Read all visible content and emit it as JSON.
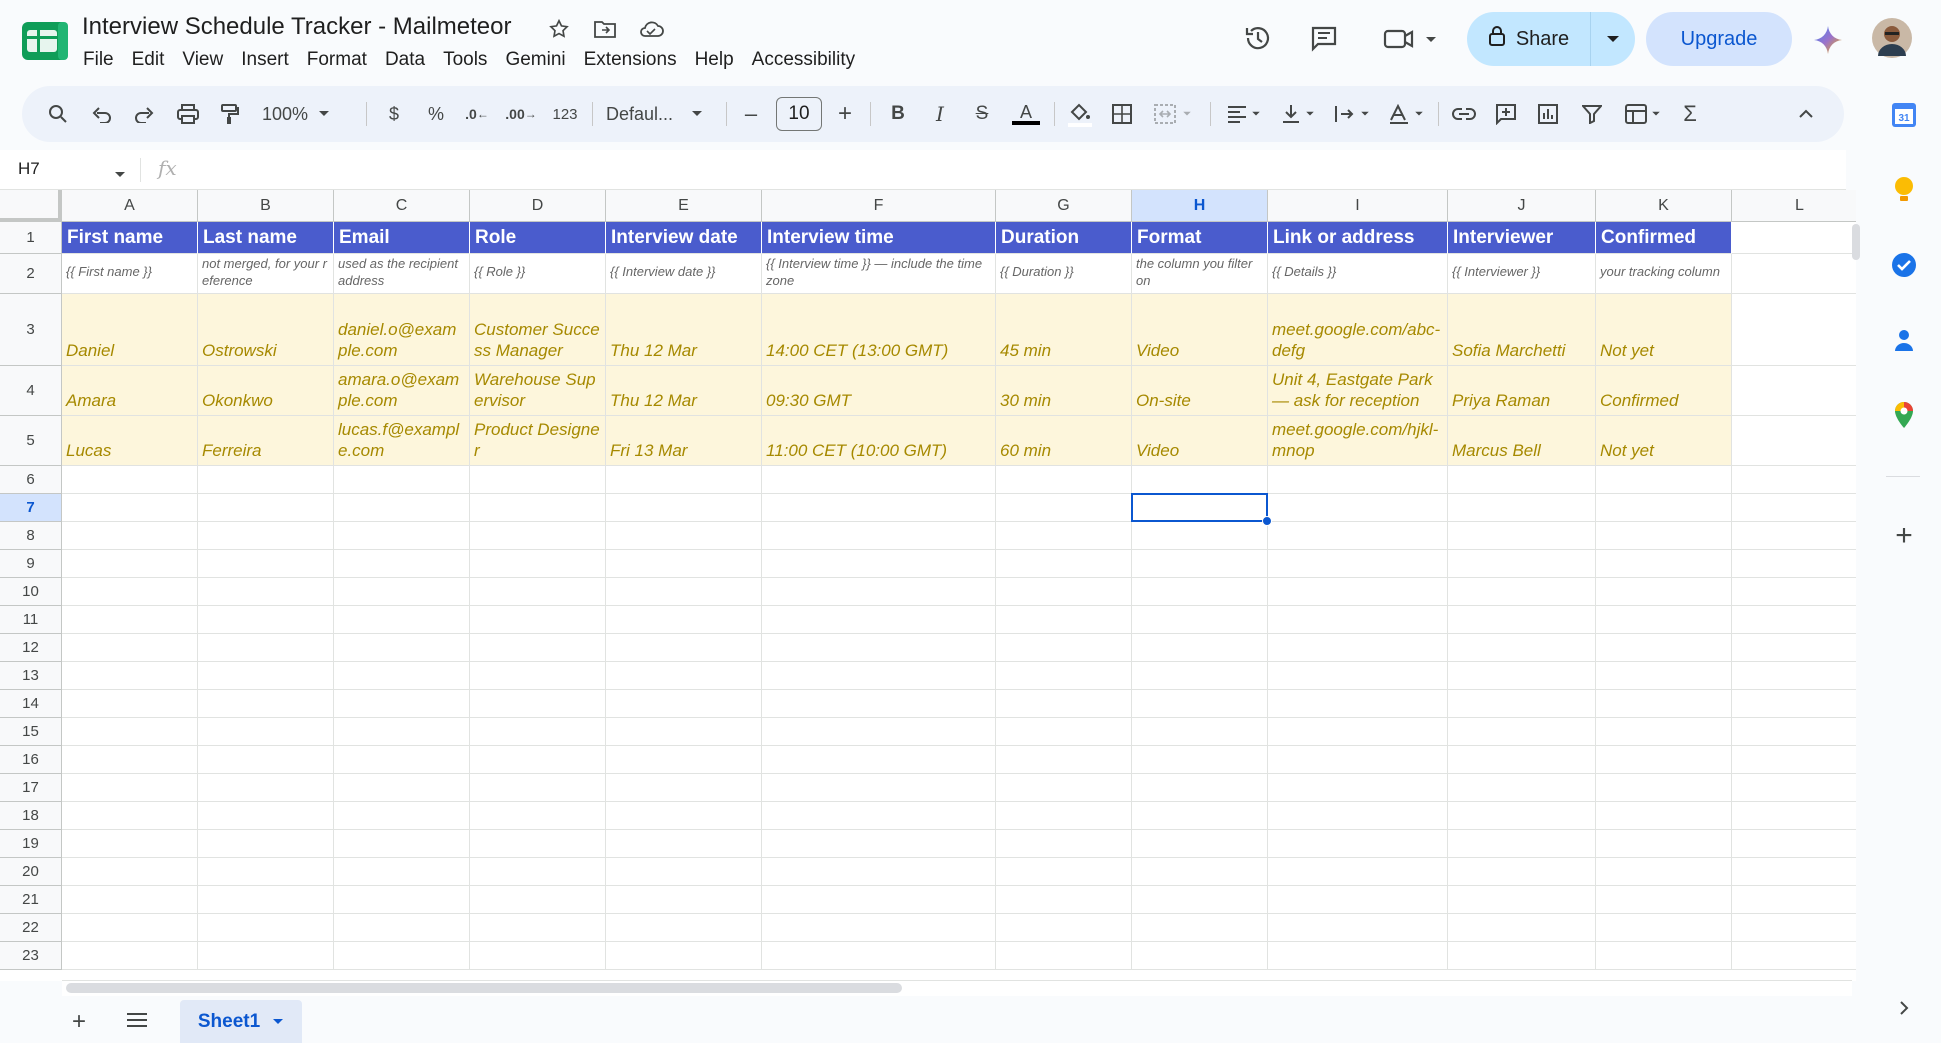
{
  "doc": {
    "title": "Interview Schedule Tracker - Mailmeteor"
  },
  "menu": [
    "File",
    "Edit",
    "View",
    "Insert",
    "Format",
    "Data",
    "Tools",
    "Gemini",
    "Extensions",
    "Help",
    "Accessibility"
  ],
  "header_actions": {
    "share_label": "Share",
    "upgrade_label": "Upgrade"
  },
  "toolbar": {
    "zoom": "100%",
    "currency": "$",
    "percent": "%",
    "format_123": "123",
    "font": "Defaul...",
    "font_size": "10"
  },
  "formula_bar": {
    "name_box": "H7",
    "fx": "fx",
    "value": ""
  },
  "grid": {
    "selected_cell": "H7",
    "columns": [
      "A",
      "B",
      "C",
      "D",
      "E",
      "F",
      "G",
      "H",
      "I",
      "J",
      "K",
      "L"
    ],
    "rows": [
      "1",
      "2",
      "3",
      "4",
      "5",
      "6",
      "7",
      "8",
      "9",
      "10",
      "11",
      "12",
      "13",
      "14",
      "15",
      "16",
      "17",
      "18",
      "19",
      "20",
      "21",
      "22",
      "23"
    ],
    "header_row": [
      "First name",
      "Last name",
      "Email",
      "Role",
      "Interview date",
      "Interview time",
      "Duration",
      "Format",
      "Link or address",
      "Interviewer",
      "Confirmed"
    ],
    "hint_row": [
      "{{ First name }}",
      "not merged, for your reference",
      "used as the recipient address",
      "{{ Role }}",
      "{{ Interview date }}",
      "{{ Interview time }} — include the time zone",
      "{{ Duration }}",
      "the column you filter on",
      "{{ Details }}",
      "{{ Interviewer }}",
      "your tracking column"
    ],
    "data_rows": [
      [
        "Daniel",
        "Ostrowski",
        "daniel.o@example.com",
        "Customer Success Manager",
        "Thu 12 Mar",
        "14:00 CET (13:00 GMT)",
        "45 min",
        "Video",
        "meet.google.com/abc-defg",
        "Sofia Marchetti",
        "Not yet"
      ],
      [
        "Amara",
        "Okonkwo",
        "amara.o@example.com",
        "Warehouse Supervisor",
        "Thu 12 Mar",
        "09:30 GMT",
        "30 min",
        "On-site",
        "Unit 4, Eastgate Park — ask for reception",
        "Priya Raman",
        "Confirmed"
      ],
      [
        "Lucas",
        "Ferreira",
        "lucas.f@example.com",
        "Product Designer",
        "Fri 13 Mar",
        "11:00 CET (10:00 GMT)",
        "60 min",
        "Video",
        "meet.google.com/hjkl-mnop",
        "Marcus Bell",
        "Not yet"
      ]
    ]
  },
  "sheets": {
    "active": "Sheet1"
  },
  "colors": {
    "header_fill": "#4a5ccd",
    "data_fill": "#fdf6dc",
    "data_text": "#a68900",
    "accent": "#0b57d0",
    "share_bg": "#c2e7ff"
  },
  "icons": [
    "sheets-logo",
    "star-icon",
    "move-folder-icon",
    "cloud-saved-icon",
    "version-history-icon",
    "comments-icon",
    "meet-icon",
    "lock-icon",
    "gemini-icon",
    "avatar",
    "search-icon",
    "undo-icon",
    "redo-icon",
    "print-icon",
    "paint-format-icon",
    "bold-icon",
    "italic-icon",
    "strikethrough-icon",
    "text-color-icon",
    "fill-color-icon",
    "borders-icon",
    "merge-icon",
    "align-icon",
    "valign-icon",
    "wrap-icon",
    "rotate-icon",
    "link-icon",
    "comment-add-icon",
    "chart-icon",
    "filter-icon",
    "table-icon",
    "functions-icon",
    "collapse-icon",
    "calendar-icon",
    "keep-icon",
    "tasks-icon",
    "contacts-icon",
    "maps-icon",
    "plus-icon",
    "add-sheet-icon",
    "all-sheets-icon"
  ]
}
